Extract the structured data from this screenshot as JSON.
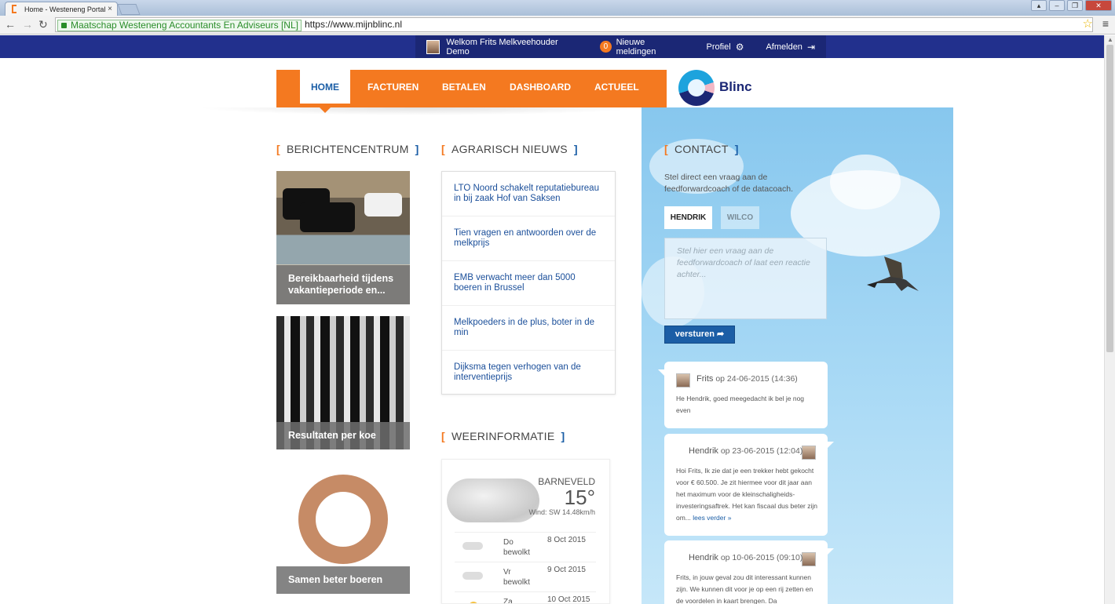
{
  "browser": {
    "tab_title": "Home - Westeneng Portal",
    "ev_label": "Maatschap Westeneng Accountants En Adviseurs [NL]",
    "url": "https://www.mijnblinc.nl"
  },
  "topbar": {
    "welcome": "Welkom Frits Melkveehouder Demo",
    "notif_count": "0",
    "notif_label": "Nieuwe meldingen",
    "profile": "Profiel",
    "logout": "Afmelden"
  },
  "nav": {
    "items": [
      "HOME",
      "FACTUREN",
      "BETALEN",
      "DASHBOARD",
      "ACTUEEL"
    ],
    "active": "HOME"
  },
  "logo": {
    "text": "Blinc"
  },
  "berichten": {
    "title": "BERICHTENCENTRUM",
    "cards": [
      "Bereikbaarheid tijdens vakantieperiode en...",
      "Resultaten per koe",
      "Samen beter boeren"
    ]
  },
  "nieuws": {
    "title": "AGRARISCH NIEUWS",
    "items": [
      "LTO Noord schakelt reputatiebureau in bij zaak Hof van Saksen",
      "Tien vragen en antwoorden over de melkprijs",
      "EMB verwacht meer dan 5000 boeren in Brussel",
      "Melkpoeders in de plus, boter in de min",
      "Dijksma tegen verhogen van de interventieprijs"
    ]
  },
  "weer": {
    "title": "WEERINFORMATIE",
    "city": "BARNEVELD",
    "temp": "15°",
    "wind": "Wind: SW 14.48km/h",
    "forecast": [
      {
        "day": "Do",
        "desc": "bewolkt",
        "date": "8 Oct 2015"
      },
      {
        "day": "Vr",
        "desc": "bewolkt",
        "date": "9 Oct 2015"
      },
      {
        "day": "Za",
        "desc": "",
        "date": "10 Oct 2015"
      }
    ]
  },
  "contact": {
    "title": "CONTACT",
    "intro": "Stel direct een vraag aan de feedforwardcoach of de datacoach.",
    "tabs": [
      "HENDRIK",
      "WILCO"
    ],
    "placeholder": "Stel hier een vraag aan de feedforwardcoach of laat een reactie achter...",
    "send": "versturen",
    "messages": [
      {
        "name": "Frits",
        "meta": "op 24-06-2015 (14:36)",
        "text": "He Hendrik, goed meegedacht ik bel je nog even",
        "more": ""
      },
      {
        "name": "Hendrik",
        "meta": "op 23-06-2015 (12:04)",
        "text": "Hoi Frits, Ik zie dat je een trekker hebt gekocht voor € 60.500. Je zit hiermee voor dit jaar aan het maximum voor de kleinschaligheids-investeringsaftrek. Het kan fiscaal dus beter zijn om...",
        "more": "lees verder »"
      },
      {
        "name": "Hendrik",
        "meta": "op 10-06-2015 (09:10)",
        "text": "Frits, in jouw geval zou dit interessant kunnen zijn. We kunnen dit voor je op een rij zetten en de voordelen in kaart brengen. Da",
        "more": ""
      }
    ]
  }
}
